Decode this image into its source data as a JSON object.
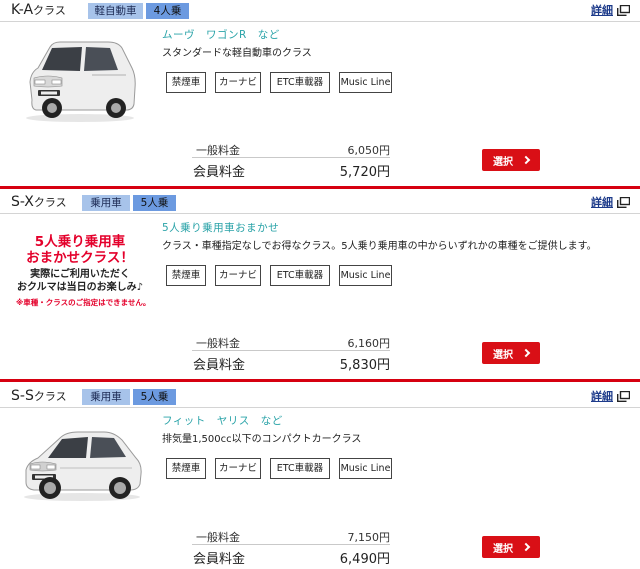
{
  "colors": {
    "accent_red": "#d90f16",
    "tag_light": "#a7c3ea",
    "tag_dark": "#6c9ae0",
    "link_blue": "#1c3a8a",
    "model_teal": "#2aa3a8"
  },
  "detail_label": "詳細",
  "detail_icon": "external-window-icon",
  "select_label": "選択",
  "select_icon": "chevron-right-icon",
  "feature_labels": [
    "禁煙車",
    "カーナビ",
    "ETC車載器",
    "Music Line"
  ],
  "plans": [
    {
      "class_main": "K-A",
      "class_sub": "クラス",
      "tag_type": "軽自動車",
      "tag_capacity": "4人乗",
      "models": "ムーヴ　ワゴンR　など",
      "description": "スタンダードな軽自動車のクラス",
      "regular_label": "一般料金",
      "regular_price": "6,050円",
      "member_label": "会員料金",
      "member_price": "5,720円",
      "image": "white-kei-car"
    },
    {
      "class_main": "S-X",
      "class_sub": "クラス",
      "tag_type": "乗用車",
      "tag_capacity": "5人乗",
      "models": "5人乗り乗用車おまかせ",
      "description": "クラス・車種指定なしでお得なクラス。5人乗り乗用車の中からいずれかの車種をご提供します。",
      "promo_line1": "5人乗り乗用車",
      "promo_line2": "おまかせクラス！",
      "promo_line3": "実際にご利用いただく",
      "promo_line4": "おクルマは当日のお楽しみ♪",
      "promo_note": "※車種・クラスのご指定はできません。",
      "regular_label": "一般料金",
      "regular_price": "6,160円",
      "member_label": "会員料金",
      "member_price": "5,830円"
    },
    {
      "class_main": "S-S",
      "class_sub": "クラス",
      "tag_type": "乗用車",
      "tag_capacity": "5人乗",
      "models": "フィット　ヤリス　など",
      "description": "排気量1,500cc以下のコンパクトカークラス",
      "regular_label": "一般料金",
      "regular_price": "7,150円",
      "member_label": "会員料金",
      "member_price": "6,490円",
      "image": "white-compact-car"
    }
  ]
}
